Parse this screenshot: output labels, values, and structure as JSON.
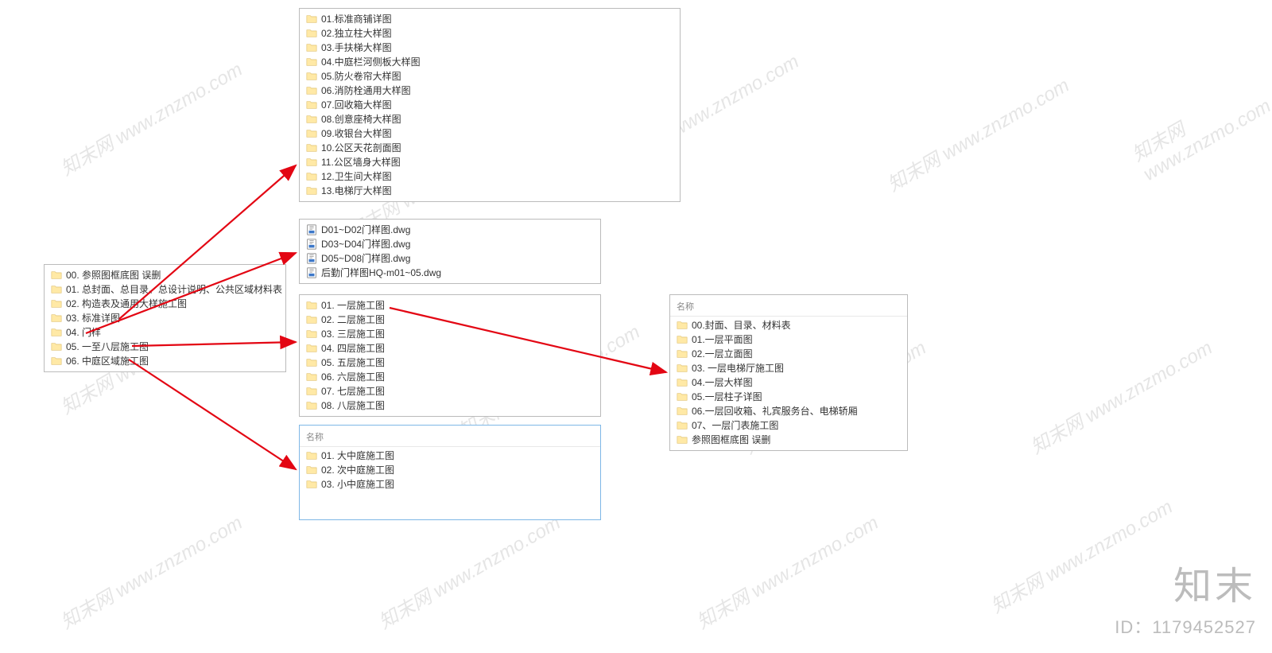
{
  "watermark_text": "知末网 www.znzmo.com",
  "brand": {
    "text": "知末",
    "id": "ID：1179452527"
  },
  "panel_root": {
    "items": [
      "00. 参照图框底图 误删",
      "01. 总封面、总目录、总设计说明、公共区域材料表",
      "02. 构造表及通用大样施工图",
      "03. 标准详图",
      "04. 门样",
      "05. 一至八层施工图",
      "06. 中庭区域施工图"
    ]
  },
  "panel_detail": {
    "items": [
      "01.标准商铺详图",
      "02.独立柱大样图",
      "03.手扶梯大样图",
      "04.中庭栏河侧板大样图",
      "05.防火卷帘大样图",
      "06.消防栓通用大样图",
      "07.回收箱大样图",
      "08.创意座椅大样图",
      "09.收银台大样图",
      "10.公区天花剖面图",
      "11.公区墙身大样图",
      "12.卫生间大样图",
      "13.电梯厅大样图"
    ]
  },
  "panel_dwg": {
    "items": [
      "D01~D02门样图.dwg",
      "D03~D04门样图.dwg",
      "D05~D08门样图.dwg",
      "后勤门样图HQ-m01~05.dwg"
    ]
  },
  "panel_floors": {
    "items": [
      "01. 一层施工图",
      "02. 二层施工图",
      "03. 三层施工图",
      "04. 四层施工图",
      "05. 五层施工图",
      "06. 六层施工图",
      "07. 七层施工图",
      "08. 八层施工图"
    ]
  },
  "panel_atrium": {
    "header": "名称",
    "items": [
      "01. 大中庭施工图",
      "02. 次中庭施工图",
      "03. 小中庭施工图"
    ]
  },
  "panel_floor1": {
    "header": "名称",
    "items": [
      "00.封面、目录、材料表",
      "01.一层平面图",
      "02.一层立面图",
      "03. 一层电梯厅施工图",
      "04.一层大样图",
      "05.一层柱子详图",
      "06.一层回收箱、礼宾服务台、电梯轿厢",
      "07、一层门表施工图",
      "参照图框底图 误删"
    ]
  }
}
